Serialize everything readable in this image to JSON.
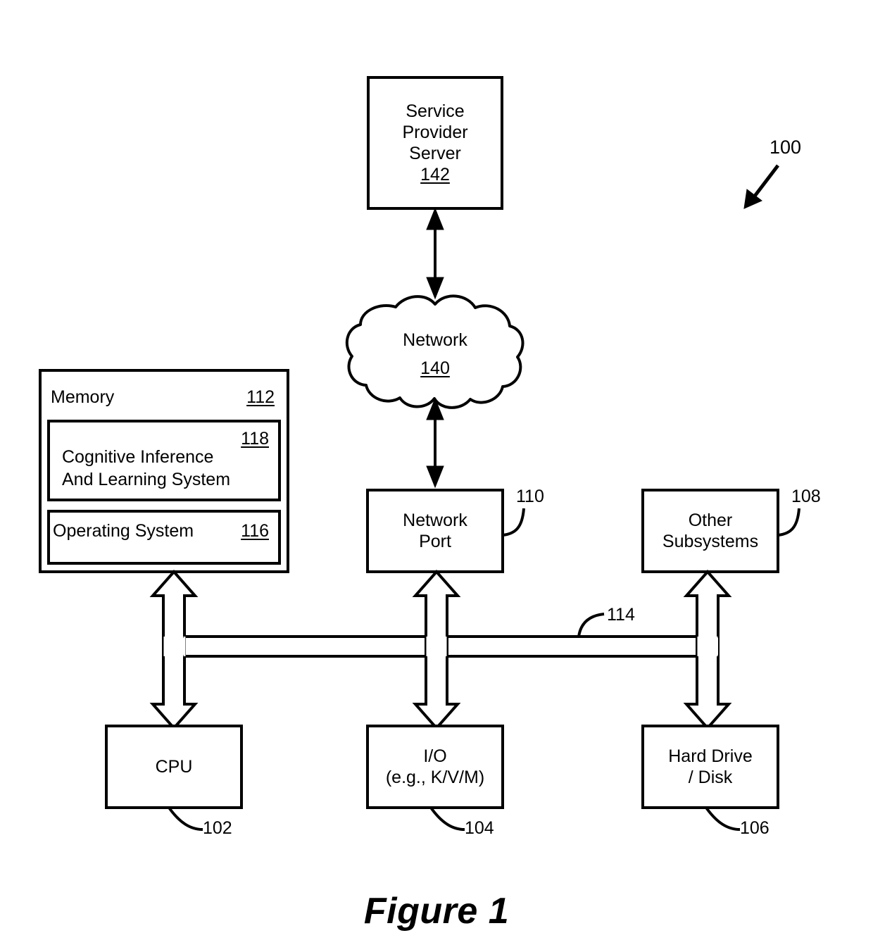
{
  "figure": {
    "caption": "Figure 1",
    "system_ref": "100"
  },
  "nodes": {
    "service_provider_server": {
      "label_lines": [
        "Service",
        "Provider",
        "Server"
      ],
      "label": "Service Provider Server",
      "ref": "142"
    },
    "network_cloud": {
      "label": "Network",
      "ref": "140"
    },
    "memory": {
      "label": "Memory",
      "ref": "112",
      "children": [
        {
          "label_lines": [
            "Cognitive Inference",
            "And Learning System"
          ],
          "label": "Cognitive Inference And Learning System",
          "ref": "118"
        },
        {
          "label": "Operating System",
          "ref": "116"
        }
      ]
    },
    "network_port": {
      "label_lines": [
        "Network",
        "Port"
      ],
      "label": "Network Port",
      "ref": "110"
    },
    "other_subsystems": {
      "label_lines": [
        "Other",
        "Subsystems"
      ],
      "label": "Other Subsystems",
      "ref": "108"
    },
    "cpu": {
      "label": "CPU",
      "ref": "102"
    },
    "io": {
      "label_lines": [
        "I/O",
        "(e.g., K/V/M)"
      ],
      "label": "I/O (e.g., K/V/M)",
      "ref": "104"
    },
    "hard_drive": {
      "label_lines": [
        "Hard Drive",
        "/ Disk"
      ],
      "label": "Hard Drive / Disk",
      "ref": "106"
    },
    "bus": {
      "ref": "114"
    }
  },
  "colors": {
    "stroke": "#000000",
    "background": "#ffffff"
  }
}
